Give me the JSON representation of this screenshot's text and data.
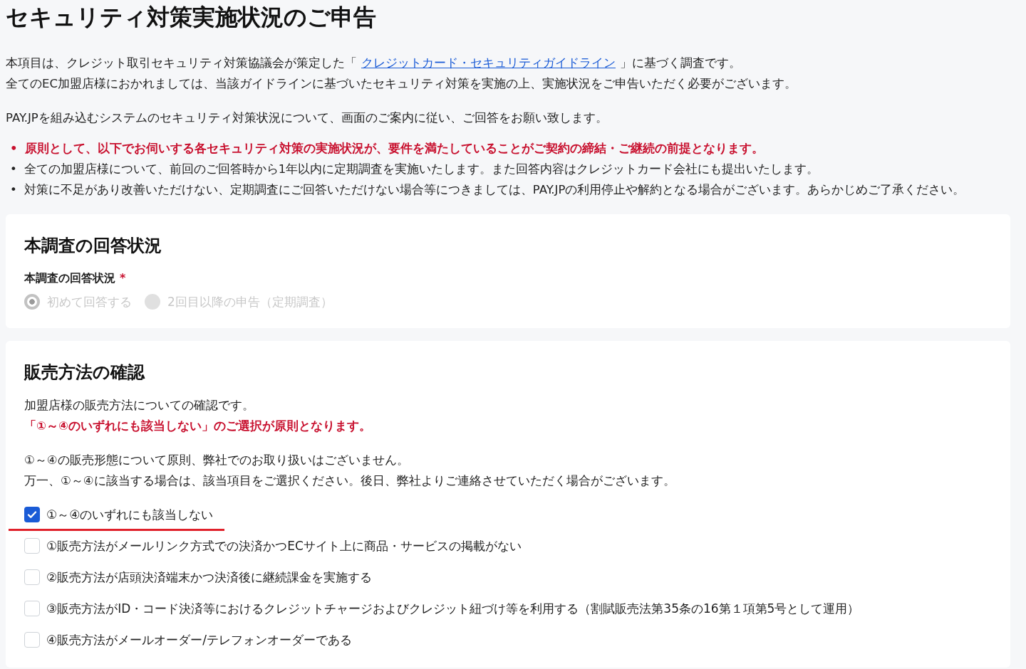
{
  "title": "セキュリティ対策実施状況のご申告",
  "intro": {
    "before": "本項目は、クレジット取引セキュリティ対策協議会が策定した「",
    "link": "クレジットカード・セキュリティガイドライン",
    "after": "」に基づく調査です。",
    "line2": "全てのEC加盟店様におかれましては、当該ガイドラインに基づいたセキュリティ対策を実施の上、実施状況をご申告いただく必要がございます。"
  },
  "intro_note": "PAY.JPを組み込むシステムのセキュリティ対策状況について、画面のご案内に従い、ご回答をお願い致します。",
  "notices": [
    {
      "marker": "•",
      "text": "原則として、以下でお伺いする各セキュリティ対策の実施状況が、要件を満たしていることがご契約の締結・ご継続の前提となります。",
      "kind": "emphasis"
    },
    {
      "marker": "•",
      "text": "全ての加盟店様について、前回のご回答時から1年以内に定期調査を実施いたします。また回答内容はクレジットカード会社にも提出いたします。",
      "kind": "normal"
    },
    {
      "marker": "•",
      "text": "対策に不足があり改善いただけない、定期調査にご回答いただけない場合等につきましては、PAY.JPの利用停止や解約となる場合がございます。あらかじめご了承ください。",
      "kind": "normal"
    }
  ],
  "status_section": {
    "heading": "本調査の回答状況",
    "label": "本調査の回答状況",
    "required_mark": "*",
    "disabled": true,
    "options": [
      {
        "label": "初めて回答する",
        "selected": true
      },
      {
        "label": "2回目以降の申告（定期調査）",
        "selected": false
      }
    ]
  },
  "sales_section": {
    "heading": "販売方法の確認",
    "description": "加盟店様の販売方法についての確認です。",
    "emphasis": "「①～④のいずれにも該当しない」のご選択が原則となります。",
    "notes": [
      "①～④の販売形態について原則、弊社でのお取り扱いはございません。",
      "万一、①～④に該当する場合は、該当項目をご選択ください。後日、弊社よりご連絡させていただく場合がございます。"
    ],
    "options": [
      {
        "label": "①～④のいずれにも該当しない",
        "checked": true,
        "highlighted": true
      },
      {
        "label": "①販売方法がメールリンク方式での決済かつECサイト上に商品・サービスの掲載がない",
        "checked": false,
        "highlighted": false
      },
      {
        "label": "②販売方法が店頭決済端末かつ決済後に継続課金を実施する",
        "checked": false,
        "highlighted": false
      },
      {
        "label": "③販売方法がID・コード決済等におけるクレジットチャージおよびクレジット紐づけ等を利用する（割賦販売法第35条の16第１項第5号として運用）",
        "checked": false,
        "highlighted": false
      },
      {
        "label": "④販売方法がメールオーダー/テレフォンオーダーである",
        "checked": false,
        "highlighted": false
      }
    ]
  }
}
